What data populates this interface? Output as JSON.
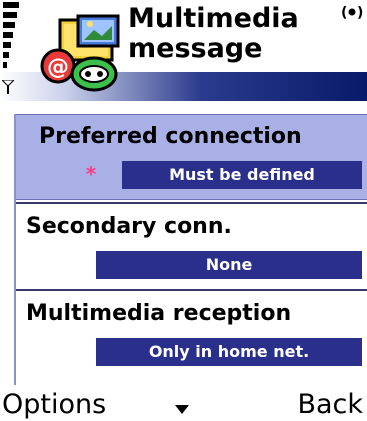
{
  "header": {
    "title_line1": "Multimedia",
    "title_line2": "message",
    "app_icon": "multimedia-message-icon",
    "signal_icon": "signal-strength-icon",
    "antenna_icon": "antenna-icon",
    "status_icon": "active-connection-indicator-icon"
  },
  "settings": {
    "items": [
      {
        "label": "Preferred connection",
        "value": "Must be defined",
        "required_icon": "asterisk-required-icon",
        "required_glyph": "*"
      },
      {
        "label": "Secondary conn.",
        "value": "None"
      },
      {
        "label": "Multimedia reception",
        "value": "Only in home net."
      }
    ]
  },
  "softkeys": {
    "left": "Options",
    "right": "Back",
    "scroll_icon": "scroll-down-arrow-icon"
  },
  "colors": {
    "selection_bg": "#a8b0e6",
    "value_bg": "#2b2f8c",
    "value_text": "#ffffff",
    "required_mark": "#ff3c8a",
    "header_band_dark": "#0a1a6a"
  }
}
